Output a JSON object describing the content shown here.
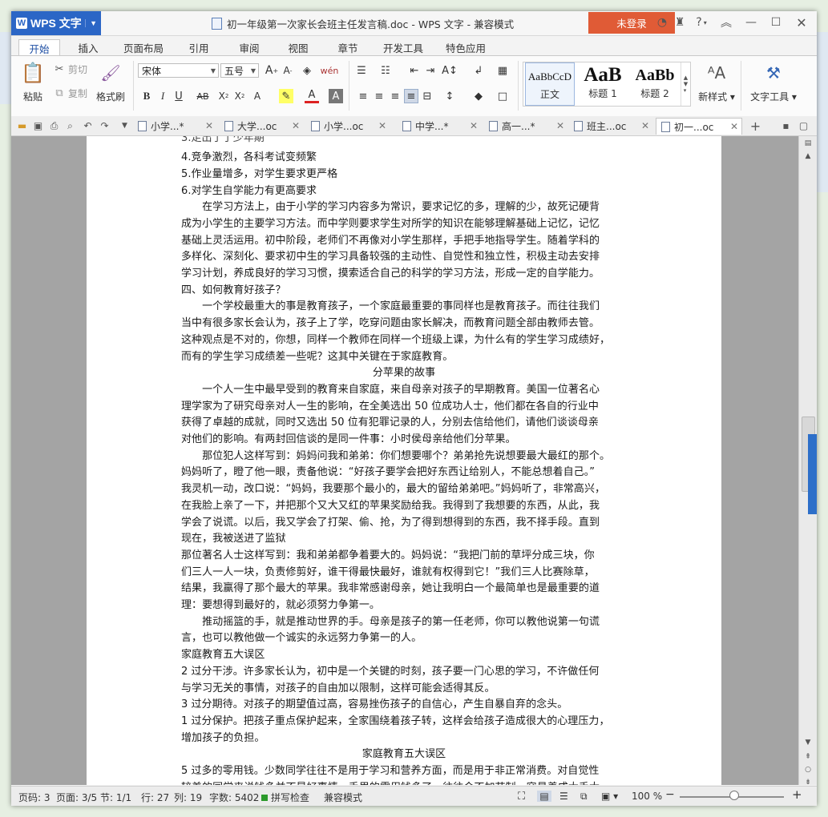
{
  "app": {
    "name": "WPS 文字",
    "login_label": "未登录"
  },
  "window": {
    "title": "初一年级第一次家长会班主任发言稿.doc - WPS 文字 - 兼容模式"
  },
  "ribbon_tabs": [
    "开始",
    "插入",
    "页面布局",
    "引用",
    "审阅",
    "视图",
    "章节",
    "开发工具",
    "特色应用"
  ],
  "ribbon": {
    "paste": "粘贴",
    "cut": "剪切",
    "copy": "复制",
    "format_painter": "格式刷",
    "font_name": "宋体",
    "font_size": "五号",
    "styles": [
      {
        "preview": "AaBbCcD",
        "name": "正文"
      },
      {
        "preview": "AaB",
        "name": "标题 1"
      },
      {
        "preview": "AaBb",
        "name": "标题 2"
      }
    ],
    "new_style": "新样式",
    "text_tools": "文字工具"
  },
  "doc_tabs": [
    {
      "label": "小学...*",
      "active": false
    },
    {
      "label": "大学...oc",
      "active": false
    },
    {
      "label": "小学...oc",
      "active": false
    },
    {
      "label": "中学...*",
      "active": false
    },
    {
      "label": "高一...*",
      "active": false
    },
    {
      "label": "班主...oc",
      "active": false
    },
    {
      "label": "初一...oc",
      "active": true
    }
  ],
  "document_lines": [
    "4.竞争激烈，各科考试变频繁",
    "5.作业量增多，对学生要求更严格",
    "6.对学生自学能力有更高要求",
    "　　在学习方法上，由于小学的学习内容多为常识，要求记忆的多，理解的少，故死记硬背",
    "成为小学生的主要学习方法。而中学则要求学生对所学的知识在能够理解基础上记忆，记忆",
    "基础上灵活运用。初中阶段，老师们不再像对小学生那样，手把手地指导学生。随着学科的",
    "多样化、深刻化、要求初中生的学习具备较强的主动性、自觉性和独立性，积极主动去安排",
    "学习计划，养成良好的学习习惯，摸索适合自己的科学的学习方法，形成一定的自学能力。",
    "四、如何教育好孩子？",
    "　　一个学校最重大的事是教育孩子，一个家庭最重要的事同样也是教育孩子。而往往我们",
    "当中有很多家长会认为，孩子上了学，吃穿问题由家长解决，而教育问题全部由教师去管。",
    "这种观点是不对的，你想，同样一个教师在同样一个班级上课，为什么有的学生学习成绩好，",
    "而有的学生学习成绩差一些呢？这其中关键在于家庭教育。",
    "分苹果的故事",
    "　　一个人一生中最早受到的教育来自家庭，来自母亲对孩子的早期教育。美国一位著名心",
    "理学家为了研究母亲对人一生的影响，在全美选出 50 位成功人士，他们都在各自的行业中",
    "获得了卓越的成就，同时又选出 50 位有犯罪记录的人，分别去信给他们，请他们谈谈母亲",
    "对他们的影响。有两封回信谈的是同一件事：小时侯母亲给他们分苹果。",
    "　　那位犯人这样写到：妈妈问我和弟弟：你们想要哪个？弟弟抢先说想要最大最红的那个。",
    "妈妈听了，瞪了他一眼，责备他说：“好孩子要学会把好东西让给别人，不能总想着自己。”",
    "我灵机一动，改口说：“妈妈，我要那个最小的，最大的留给弟弟吧。”妈妈听了，非常高兴，",
    "在我脸上亲了一下，并把那个又大又红的苹果奖励给我。我得到了我想要的东西，从此，我",
    "学会了说谎。以后，我又学会了打架、偷、抢，为了得到想得到的东西，我不择手段。直到",
    "现在，我被送进了监狱",
    "那位著名人士这样写到：我和弟弟都争着要大的。妈妈说：“我把门前的草坪分成三块，你",
    "们三人一人一块，负责修剪好，谁干得最快最好，谁就有权得到它！”我们三人比赛除草，",
    "结果，我赢得了那个最大的苹果。我非常感谢母亲，她让我明白一个最简单也是最重要的道",
    "理：要想得到最好的，就必须努力争第一。",
    "　　推动摇篮的手，就是推动世界的手。母亲是孩子的第一任老师，你可以教他说第一句谎",
    "言，也可以教他做一个诚实的永远努力争第一的人。",
    "家庭教育五大误区",
    "2 过分干涉。许多家长认为，初中是一个关键的时刻，孩子要一门心思的学习，不许做任何",
    "与学习无关的事情，对孩子的自由加以限制，这样可能会适得其反。",
    "3 过分期待。对孩子的期望值过高，容易挫伤孩子的自信心，产生自暴自弃的念头。",
    "1 过分保护。把孩子重点保护起来，全家围绕着孩子转，这样会给孩子造成很大的心理压力，",
    "增加孩子的负担。",
    "家庭教育五大误区",
    "5 过多的零用钱。少数同学往往不是用于学习和营养方面，而是用于非正常消费。对自觉性",
    "较差的同学来说钱多并不是好事情，手里的零用钱多了，往往会不加节制，容易养成大手大"
  ],
  "status": {
    "page_code": "页码: 3",
    "pages": "页面: 3/5",
    "section": "节: 1/1",
    "row": "行: 27",
    "column": "列: 19",
    "word_count": "字数: 5402",
    "spell_check": "拼写检查",
    "compat": "兼容模式",
    "zoom": "100 %"
  },
  "colors": {
    "accent": "#2b66c6",
    "login": "#e05b36"
  }
}
